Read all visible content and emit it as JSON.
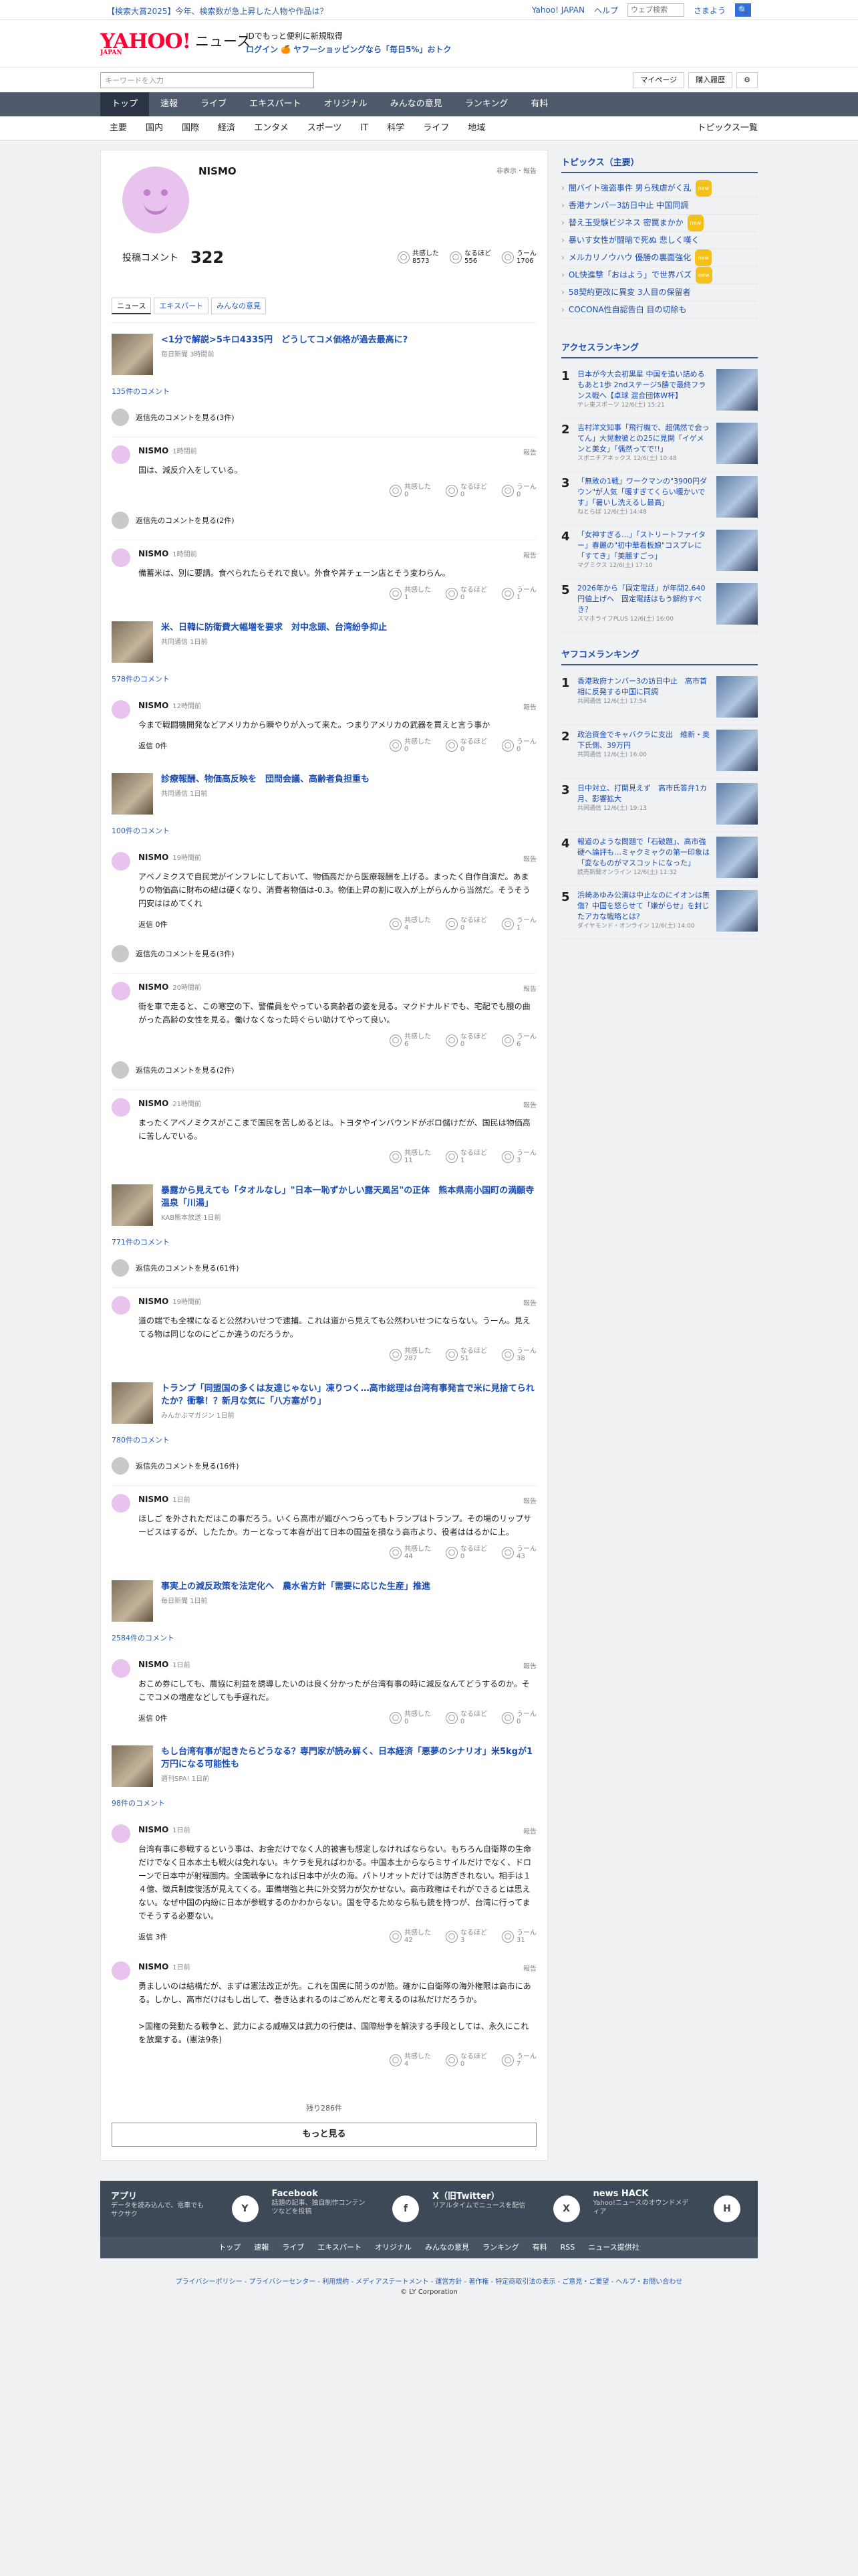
{
  "banner": {
    "promo": "【検索大賞2025】今年、検索数が急上昇した人物や作品は？",
    "links": [
      "Yahoo! JAPAN",
      "ヘルプ"
    ],
    "search_placeholder": "ウェブ検索",
    "search_button": "🔍",
    "user": "さまよう"
  },
  "header": {
    "logo": "YAHOO!",
    "logo_sub": "JAPAN",
    "title": "ニュース",
    "msg1": "IDでもっと便利に新規取得",
    "msg2": "ログイン 🍊 ヤフーショッピングなら「毎日5%」おトク"
  },
  "search": {
    "placeholder": "キーワードを入力",
    "mypage": "マイページ",
    "history": "購入履歴",
    "gear": "⚙"
  },
  "nav1": [
    "トップ",
    "速報",
    "ライブ",
    "エキスパート",
    "オリジナル",
    "みんなの意見",
    "ランキング",
    "有料"
  ],
  "nav2": [
    "主要",
    "国内",
    "国際",
    "経済",
    "エンタメ",
    "スポーツ",
    "IT",
    "科学",
    "ライフ",
    "地域"
  ],
  "nav2_right": "トピックス一覧",
  "profile": {
    "name": "NISMO",
    "link": "非表示・報告",
    "label": "投稿コメント",
    "count": "322",
    "reacts": [
      {
        "label": "共感した",
        "value": "8573",
        "icon": "◯"
      },
      {
        "label": "なるほど",
        "value": "556",
        "icon": "◯"
      },
      {
        "label": "うーん",
        "value": "1706",
        "icon": "◯"
      }
    ]
  },
  "tabs": [
    "ニュース",
    "エキスパート",
    "みんなの意見"
  ],
  "articles": [
    {
      "title": "<1分で解説>5キロ4335円　どうしてコメ価格が過去最高に?",
      "src": "毎日新聞 3時間前",
      "count": "135件のコメント",
      "items": [
        {
          "more": "返信先のコメントを見る(3件)"
        },
        {
          "time": "1時間前",
          "text": "国は、減反介入をしている。",
          "r": [
            "0",
            "0",
            "0"
          ]
        },
        {
          "more": "返信先のコメントを見る(2件)"
        },
        {
          "time": "1時間前",
          "text": "備蓄米は、別に要請。食べられたらそれで良い。外食や丼チェーン店とそう変わらん。",
          "r": [
            "1",
            "0",
            "1"
          ]
        }
      ]
    },
    {
      "title": "米、日韓に防衛費大幅増を要求　対中念頭、台湾紛争抑止",
      "src": "共同通信 1日前",
      "count": "578件のコメント",
      "items": [
        {
          "time": "12時間前",
          "text": "今まで戦闘機開発などアメリカから瞬やりが入って来た。つまりアメリカの武器を買えと言う事か",
          "reply": "返信 0件",
          "r": [
            "0",
            "0",
            "0"
          ]
        }
      ]
    },
    {
      "title": "診療報酬、物価高反映を　団問会議、高齢者負担重も",
      "src": "共同通信 1日前",
      "count": "100件のコメント",
      "items": [
        {
          "time": "19時間前",
          "text": "アベノミクスで自民党がインフレにしておいて、物価高だから医療報酬を上げる。まったく自作自演だ。あまりの物価高に財布の紐は硬くなり、消費者物価は-0.3。物価上昇の割に収入が上がらんから当然だ。そうそう円安ははめてくれ",
          "reply": "返信 0件",
          "r": [
            "4",
            "0",
            "1"
          ]
        },
        {
          "more": "返信先のコメントを見る(3件)"
        },
        {
          "time": "20時間前",
          "text": "街を車で走ると、この寒空の下、警備員をやっている高齢者の姿を見る。マクドナルドでも、宅配でも腰の曲がった高齢の女性を見る。働けなくなった時ぐらい助けてやって良い。",
          "r": [
            "6",
            "0",
            "6"
          ]
        },
        {
          "more": "返信先のコメントを見る(2件)"
        },
        {
          "time": "21時間前",
          "text": "まったくアベノミクスがここまで国民を苦しめるとは。トヨタやインバウンドがボロ儲けだが、国民は物価高に苦しんでいる。",
          "r": [
            "11",
            "1",
            "3"
          ]
        }
      ]
    },
    {
      "title": "暴露から見えても「タオルなし」\"日本一恥ずかしい露天風呂\"の正体　熊本県南小国町の満願寺温泉「川湯」",
      "src": "KAB熊本放送 1日前",
      "count": "771件のコメント",
      "items": [
        {
          "more": "返信先のコメントを見る(61件)"
        },
        {
          "time": "19時間前",
          "text": "道の端でも全裸になると公然わいせつで逮捕。これは道から見えても公然わいせつにならない。うーん。見えてる物は同じなのにどこか違うのだろうか。",
          "r": [
            "287",
            "51",
            "38"
          ]
        }
      ]
    },
    {
      "title": "トランプ「同盟国の多くは友達じゃない」凍りつく…高市総理は台湾有事発言で米に見捨てられたか？衝撃！？新月な気に「八方塞がり」",
      "src": "みんかぶマガジン 1日前",
      "count": "780件のコメント",
      "items": [
        {
          "more": "返信先のコメントを見る(16件)"
        },
        {
          "time": "1日前",
          "text": "ほしご を外されただはこの事だろう。いくら高市が媚びへつらってもトランプはトランプ。その場のリップサービスはするが、したたか。カーとなって本音が出て日本の国益を損なう高市より、役者ははるかに上。",
          "r": [
            "44",
            "0",
            "43"
          ]
        }
      ]
    },
    {
      "title": "事実上の減反政策を法定化へ　農水省方針「需要に応じた生産」推進",
      "src": "毎日新聞 1日前",
      "count": "2584件のコメント",
      "items": [
        {
          "time": "1日前",
          "text": "おこめ券にしても、農協に利益を誘導したいのは良く分かったが台湾有事の時に減反なんてどうするのか。そこでコメの増産などしても手遅れだ。",
          "reply": "返信 0件",
          "r": [
            "0",
            "0",
            "0"
          ]
        }
      ]
    },
    {
      "title": "もし台湾有事が起きたらどうなる？専門家が読み解く、日本経済「悪夢のシナリオ」米5kgが1万円になる可能性も",
      "src": "週刊SPA! 1日前",
      "count": "98件のコメント",
      "items": [
        {
          "time": "1日前",
          "text": "台湾有事に参戦するという事は、お金だけでなく人的被害も想定しなければならない。もちろん自衛隊の生命だけでなく日本本土も戦火は免れない。キケラを見ればわかる。中国本土からならミサイルだけでなく、ドローンで日本中が射程圏内。全国戦争になれば日本中が火の海。パトリオットだけでは防ぎきれない。相手は１４億、徴兵制度復活が見えてくる。軍備増強と共に外交努力が欠かせない。高市政権はそれができるとは思えない。なぜ中国の内紛に日本が参戦するのかわからない。国を守るためなら私も銃を持つが、台湾に行ってまでそうする必要ない。",
          "reply": "返信 3件",
          "r": [
            "42",
            "3",
            "31"
          ]
        },
        {
          "time": "1日前",
          "text": "勇ましいのは結構だが、まずは憲法改正が先。これを国民に問うのが筋。確かに自衛隊の海外権限は高市にある。しかし、高市だけはもし出して、巻き込まれるのはごめんだと考えるのは私だけだろうか。\n\n>国権の発動たる戦争と、武力による威嚇又は武力の行使は、国際紛争を解決する手段としては、永久にこれを放棄する。(憲法9条)",
          "r": [
            "4",
            "0",
            "7"
          ]
        }
      ]
    }
  ],
  "more_label": "残り286件",
  "more_button": "もっと見る",
  "side": {
    "topics_title": "トピックス（主要）",
    "topics": [
      {
        "t": "闇バイト強盗事件 男ら残虐がく乱",
        "n": "new"
      },
      {
        "t": "香港ナンバー3訪日中止 中国同調",
        "n": ""
      },
      {
        "t": "替え玉受験ビジネス 密罠まかか",
        "n": "new"
      },
      {
        "t": "暴いす女性が闘暗で死ぬ 悲しく嘆く",
        "n": ""
      },
      {
        "t": "メルカリノウハウ 優勝の裏面強化",
        "n": "new"
      },
      {
        "t": "OL快進撃「おはよう」で世界バズ",
        "n": "new"
      },
      {
        "t": "58契約更改に異変 3人目の保留者",
        "n": ""
      },
      {
        "t": "COCONA性自認告白 目の切除も",
        "n": ""
      }
    ],
    "access_title": "アクセスランキング",
    "access": [
      {
        "t": "日本が今大会初黒星 中国を追い詰めるもあと1歩 2ndステージ5勝で最終フランス戦へ【卓球 混合団体W杯】",
        "s": "テレ東スポーツ 12/6(土) 15:21"
      },
      {
        "t": "吉村洋文知事「飛行機で、超偶然で会ってん」大晃敷彼との25に見開「イゲメンと美女」「偶然ってで!!」",
        "s": "スポニチアネックス 12/6(土) 10:48"
      },
      {
        "t": "「無敗の1戦」ワークマンの\"3900円ダウン\"が人気「暖すぎてくらい暖かいです」「暑いし洗えるし最高」",
        "s": "ねとらぼ 12/6(土) 14:48"
      },
      {
        "t": "「女神すぎる…」「ストリートファイター」春麗の\"初中華看板娘\"コスプレに「すてき」「美麗すごっ」",
        "s": "マグミクス 12/6(土) 17:10"
      },
      {
        "t": "2026年から「固定電話」が年間2,640円値上げへ　固定電話はもう解約すべき？",
        "s": "スマホライフPLUS 12/6(土) 16:00"
      }
    ],
    "yafuco_title": "ヤフコメランキング",
    "yafuco": [
      {
        "t": "香港政府ナンバー3の訪日中止　高市首相に反発する中国に同調",
        "s": "共同通信 12/6(土) 17:54"
      },
      {
        "t": "政治資金でキャバクラに支出　維新・奥下氏側、39万円",
        "s": "共同通信 12/6(土) 16:00"
      },
      {
        "t": "日中対立、打開見えず　高市氏答弁1カ月、影響拡大",
        "s": "共同通信 12/6(土) 19:13"
      },
      {
        "t": "報道のような問題で「石破題」、高市強硬へ論評も…ミャクミャクの第一印象は「変なものがマスコットになった」",
        "s": "読売新聞オンライン 12/6(土) 11:32"
      },
      {
        "t": "浜崎あゆみ公演は中止なのにイオンは無傷？中国を怒らせて「嫌がらせ」を封じたアカな戦略とは?",
        "s": "ダイヤモンド・オンライン 12/6(土) 14:00"
      }
    ]
  },
  "footer": {
    "apps": [
      {
        "b": "アプリ",
        "s": "データを読み込んで、電車でもサクサク",
        "i": "Y"
      },
      {
        "b": "Facebook",
        "s": "話題の記事、独自制作コンテンツなどを投稿",
        "i": "f"
      },
      {
        "b": "X（旧Twitter）",
        "s": "リアルタイムでニュースを配信",
        "i": "X"
      },
      {
        "b": "news HACK",
        "s": "Yahoo!ニュースのオウンドメディア",
        "i": "H"
      }
    ],
    "links": [
      "トップ",
      "速報",
      "ライブ",
      "エキスパート",
      "オリジナル",
      "みんなの意見",
      "ランキング",
      "有料",
      "RSS",
      "ニュース提供社"
    ],
    "bottom": "プライバシーポリシー - プライバシーセンター - 利用規約 - メディアステートメント - 運営方針 - 著作権 - 特定商取引法の表示 - ご意見・ご要望 - ヘルプ・お問い合わせ",
    "copy": "© LY Corporation"
  }
}
